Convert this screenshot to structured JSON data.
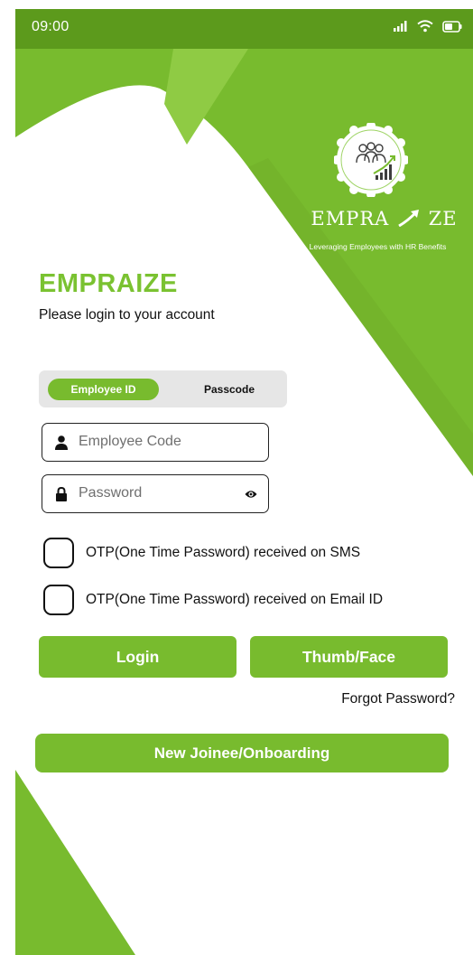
{
  "status_bar": {
    "time": "09:00",
    "icons": [
      "signal-icon",
      "wifi-icon",
      "battery-icon"
    ]
  },
  "brand": {
    "logo_icon": "people-growth-icon",
    "wordmark_left": "EMPRA",
    "wordmark_right": "ZE",
    "tagline": "Leveraging Employees with HR Benefits"
  },
  "header": {
    "title": "EMPRAIZE",
    "subtitle": "Please login to your account"
  },
  "login_mode": {
    "tabs": [
      {
        "label": "Employee ID",
        "selected": true
      },
      {
        "label": "Passcode",
        "selected": false
      }
    ]
  },
  "form": {
    "employee_code": {
      "placeholder": "Employee Code",
      "value": ""
    },
    "password": {
      "placeholder": "Password",
      "value": ""
    }
  },
  "otp_options": [
    {
      "label": "OTP(One Time Password) received on SMS",
      "checked": false
    },
    {
      "label": "OTP(One Time Password) received on Email ID",
      "checked": false
    }
  ],
  "actions": {
    "login": "Login",
    "thumb_face": "Thumb/Face",
    "forgot_password": "Forgot Password?",
    "new_joinee": "New Joinee/Onboarding"
  },
  "colors": {
    "primary": "#78bb2e",
    "status_bar": "#5c9a1c",
    "title": "#7ac231"
  }
}
